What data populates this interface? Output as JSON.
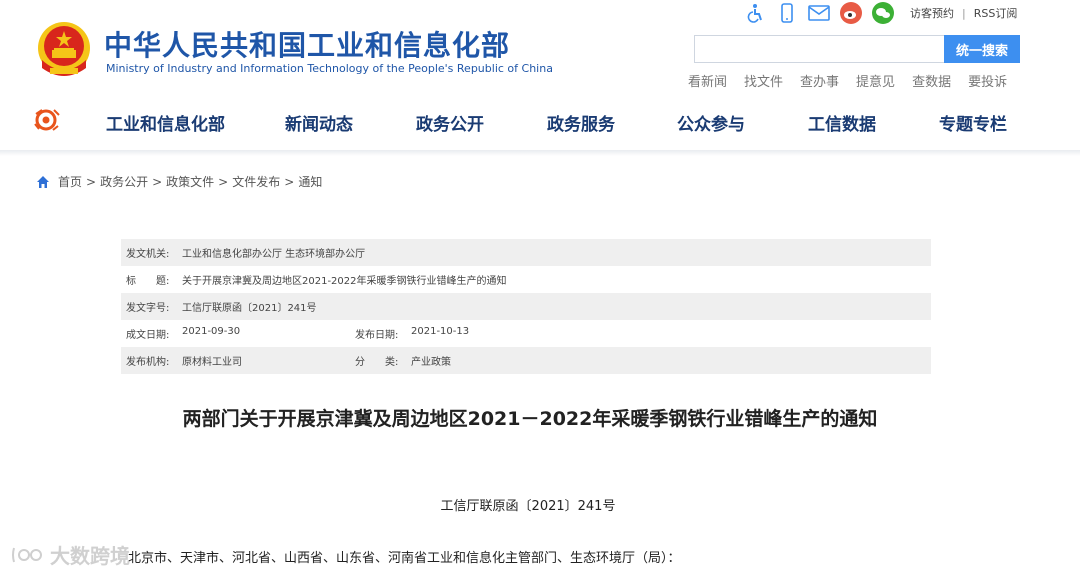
{
  "header": {
    "site_title": "中华人民共和国工业和信息化部",
    "site_subtitle": "Ministry of Industry and Information Technology of the People's Republic of China",
    "top_links": {
      "visitor": "访客预约",
      "separator": "|",
      "rss": "RSS订阅"
    },
    "top_icons": [
      "accessibility-icon",
      "mobile-icon",
      "mail-icon",
      "weibo-icon",
      "wechat-icon"
    ],
    "search": {
      "placeholder": "",
      "button_label": "统一搜索"
    },
    "quick_links": [
      "看新闻",
      "找文件",
      "查办事",
      "提意见",
      "查数据",
      "要投诉"
    ]
  },
  "nav": {
    "items": [
      "工业和信息化部",
      "新闻动态",
      "政务公开",
      "政务服务",
      "公众参与",
      "工信数据",
      "专题专栏"
    ]
  },
  "breadcrumb": {
    "items": [
      "首页",
      "政务公开",
      "政策文件",
      "文件发布",
      "通知"
    ],
    "separator": ">"
  },
  "meta": {
    "issuer_label": "发文机关:",
    "issuer_value": "工业和信息化部办公厅 生态环境部办公厅",
    "title_label": "标　　题:",
    "title_value": "关于开展京津冀及周边地区2021-2022年采暖季钢铁行业错峰生产的通知",
    "doc_no_label": "发文字号:",
    "doc_no_value": "工信厅联原函〔2021〕241号",
    "written_label": "成文日期:",
    "written_value": "2021-09-30",
    "published_label": "发布日期:",
    "published_value": "2021-10-13",
    "org_label": "发布机构:",
    "org_value": "原材料工业司",
    "category_label": "分　　类:",
    "category_value": "产业政策"
  },
  "document": {
    "title": "两部门关于开展京津冀及周边地区2021－2022年采暖季钢铁行业错峰生产的通知",
    "number": "工信厅联原函〔2021〕241号",
    "first_line": "北京市、天津市、河北省、山西省、山东省、河南省工业和信息化主管部门、生态环境厅（局）："
  },
  "watermark": {
    "text": "大数跨境"
  },
  "colors": {
    "brand_blue": "#1f56a8",
    "search_blue": "#3d8ff0",
    "nav_text": "#1a3b73",
    "emblem_red": "#d8261c",
    "emblem_gold": "#f5c518"
  }
}
